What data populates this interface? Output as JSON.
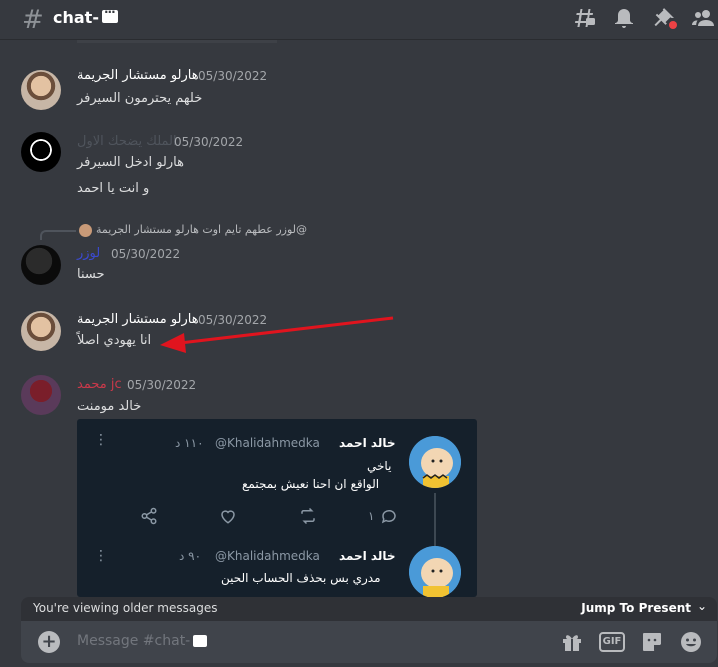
{
  "header": {
    "channel_name": "chat-",
    "icons": [
      "threads-icon",
      "bell-icon",
      "pin-icon",
      "members-icon"
    ]
  },
  "messages": [
    {
      "author": "هارلو مستشار الجريمة",
      "author_color": "#ffffff",
      "timestamp": "05/30/2022",
      "lines": [
        "خلهم يحترمون السيرفر"
      ]
    },
    {
      "author": "الملك يضحك الاول",
      "author_color": "#4f545c",
      "timestamp": "05/30/2022",
      "lines": [
        "هارلو ادخل السيرفر",
        "و انت يا احمد"
      ]
    },
    {
      "reply_to": "لوزر عطهم تايم اوت هارلو مستشار الجريمة@",
      "author": "لوزر",
      "author_color": "#3b4ad1",
      "timestamp": "05/30/2022",
      "lines": [
        "حسنا"
      ]
    },
    {
      "author": "هارلو مستشار الجريمة",
      "author_color": "#ffffff",
      "timestamp": "05/30/2022",
      "lines": [
        "انا يهودي اصلاً"
      ]
    },
    {
      "author": "محمد jc",
      "author_color": "#c9394a",
      "timestamp": "05/30/2022",
      "lines": [
        "خالد مومنت"
      ]
    }
  ],
  "embed": {
    "tweets": [
      {
        "name": "خالد احمد",
        "handle": "@Khalidahmedka",
        "time": "١١٠ د",
        "lines": [
          "ياخي",
          "الواقع ان احنا نعيش بمجتمع"
        ],
        "reply_count": "١"
      },
      {
        "name": "خالد احمد",
        "handle": "@Khalidahmedka",
        "time": "٩٠ د",
        "lines": [
          "مدري بس بحذف الحساب الحين"
        ]
      }
    ]
  },
  "older_bar": {
    "text": "You're viewing older messages",
    "jump_label": "Jump To Present"
  },
  "input": {
    "placeholder": "Message #chat-",
    "gif_label": "GIF",
    "icons": [
      "gift-icon",
      "gif-icon",
      "sticker-icon",
      "emoji-icon"
    ]
  },
  "colors": {
    "background": "#36393f",
    "annotation_arrow": "#e0141e"
  }
}
